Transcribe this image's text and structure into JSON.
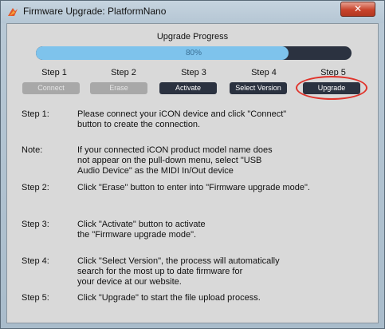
{
  "window": {
    "title": "Firmware Upgrade: PlatformNano",
    "close_label": "✕"
  },
  "progress": {
    "title": "Upgrade Progress",
    "percent_text": "80%",
    "fraction": 0.8
  },
  "steps": [
    {
      "label": "Step 1",
      "button": "Connect",
      "enabled": false
    },
    {
      "label": "Step 2",
      "button": "Erase",
      "enabled": false
    },
    {
      "label": "Step 3",
      "button": "Activate",
      "enabled": true
    },
    {
      "label": "Step 4",
      "button": "Select Version",
      "enabled": true
    },
    {
      "label": "Step 5",
      "button": "Upgrade",
      "enabled": true,
      "highlighted": true
    }
  ],
  "instructions": [
    {
      "key": "Step 1:",
      "lines": [
        "Please connect your iCON device and click \"Connect\"",
        "button to create the connection."
      ]
    },
    {
      "key": "Note:",
      "lines": [
        "If your connected iCON product model name does",
        "not appear on the pull-down menu, select \"USB",
        "Audio Device\" as the MIDI In/Out device"
      ]
    },
    {
      "key": "Step 2:",
      "lines": [
        "Click \"Erase\" button to enter into \"Firmware upgrade mode\"."
      ]
    },
    {
      "key": "Step 3:",
      "lines": [
        "Click \"Activate\" button to activate",
        "the \"Firmware upgrade mode\"."
      ]
    },
    {
      "key": "Step 4:",
      "lines": [
        "Click \"Select Version\", the process will automatically",
        "search for the most up to date firmware for",
        "your device at our website."
      ]
    },
    {
      "key": "Step 5:",
      "lines": [
        "Click \"Upgrade\" to start the file upload process."
      ]
    }
  ],
  "colors": {
    "progress_fill": "#7ec3ec",
    "progress_track": "#2b3240",
    "button_active": "#2b3240",
    "button_disabled": "#a8a8a8",
    "highlight": "#e0342c"
  }
}
